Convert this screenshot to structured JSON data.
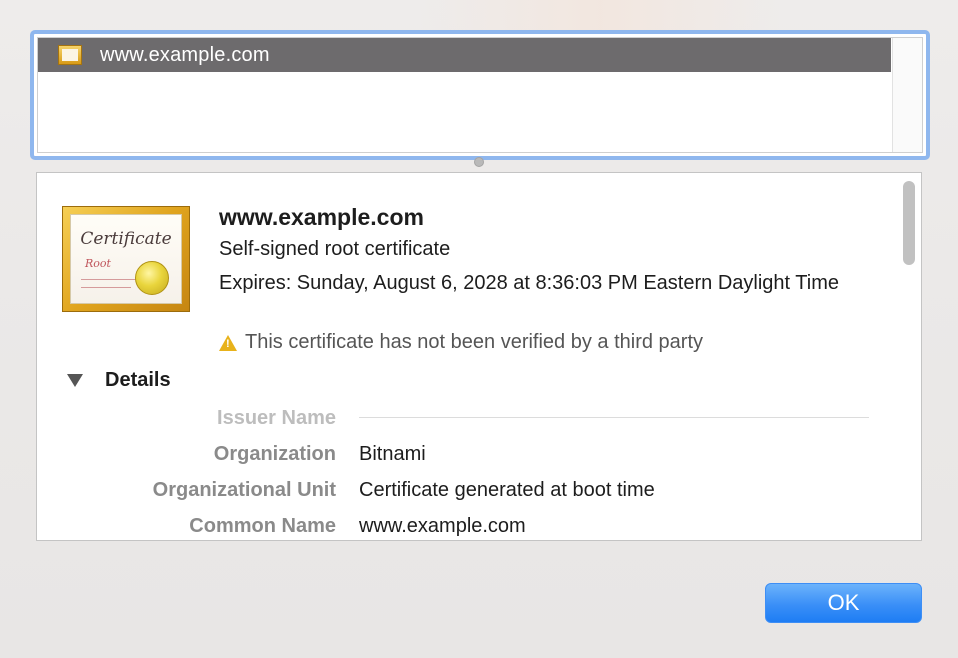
{
  "certificate_list": {
    "items": [
      {
        "label": "www.example.com",
        "icon": "certificate-icon",
        "selected": true
      }
    ]
  },
  "detail": {
    "badge": {
      "script_text": "Certificate",
      "sub_text": "Root",
      "icon": "certificate-badge-icon"
    },
    "title": "www.example.com",
    "subtitle": "Self-signed root certificate",
    "expires": "Expires: Sunday, August 6, 2028 at 8:36:03 PM Eastern Daylight Time",
    "warning": "This certificate has not been verified by a third party",
    "details_label": "Details",
    "fields": {
      "issuer_section": "Issuer Name",
      "organization_label": "Organization",
      "organization_value": "Bitnami",
      "org_unit_label": "Organizational Unit",
      "org_unit_value": "Certificate generated at boot time",
      "common_name_label": "Common Name",
      "common_name_value": "www.example.com"
    }
  },
  "buttons": {
    "ok": "OK"
  },
  "colors": {
    "accent": "#3a8ff7",
    "selection_row": "#6d6b6d",
    "focus_ring": "#8fb7ee",
    "warning": "#e8b21a"
  }
}
